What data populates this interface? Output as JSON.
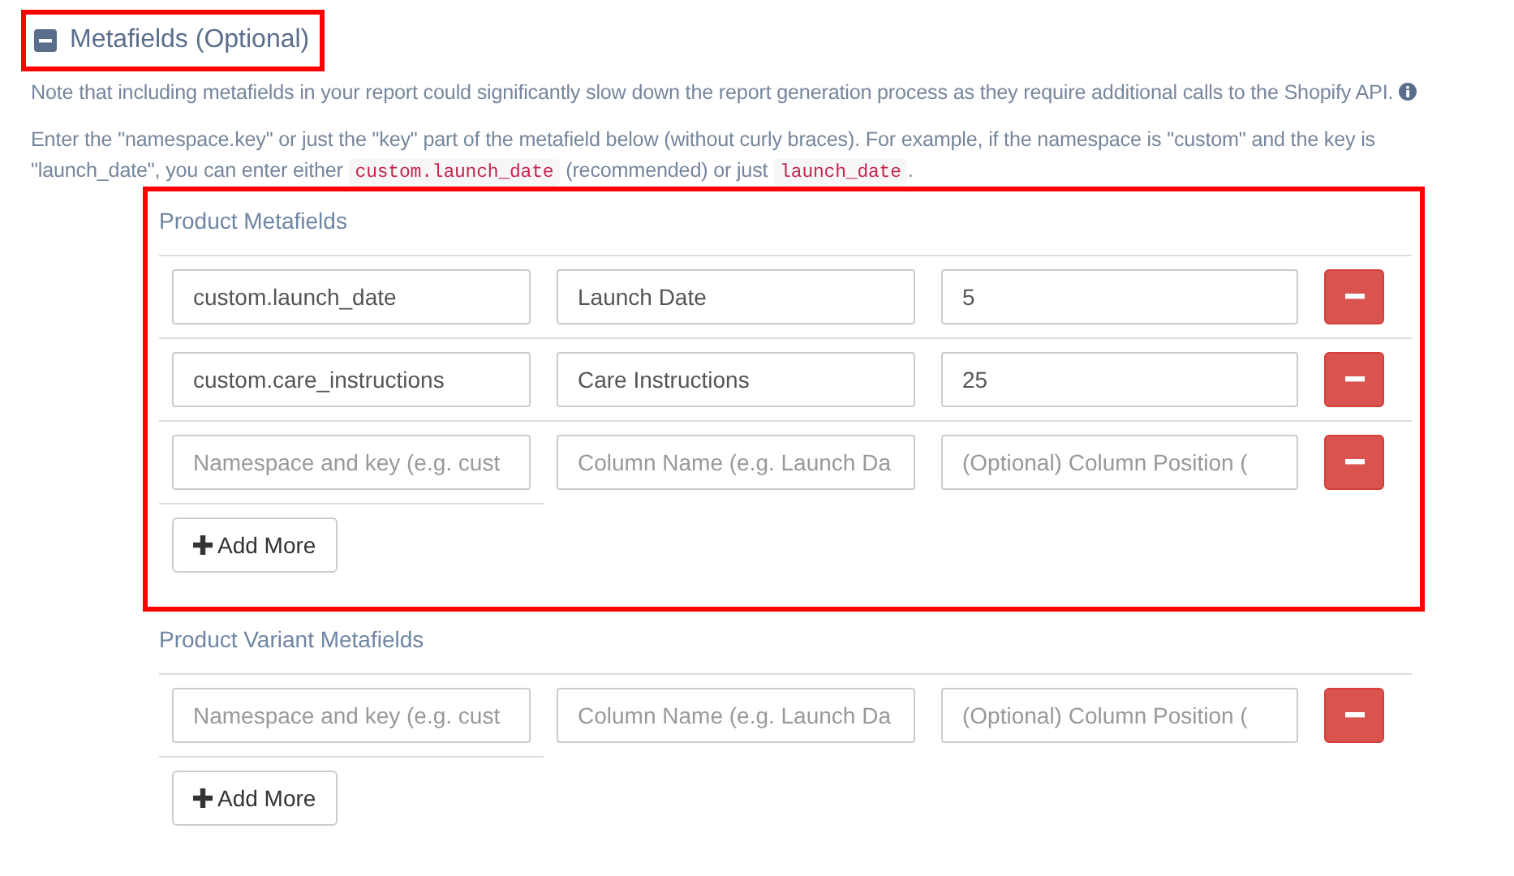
{
  "header": {
    "title": "Metafields (Optional)",
    "expanded": true,
    "highlighted": true
  },
  "note": "Note that including metafields in your report could significantly slow down the report generation process as they require additional calls to the Shopify API.",
  "instructions": [
    {
      "kind": "text",
      "text": "Enter the \"namespace.key\" or just the \"key\" part of the metafield below (without curly braces). For example, if the namespace is \"custom\" and the key is \"launch_date\", you can enter either "
    },
    {
      "kind": "code",
      "text": "custom.launch_date"
    },
    {
      "kind": "text",
      "text": " (recommended) or just "
    },
    {
      "kind": "code",
      "text": "launch_date"
    },
    {
      "kind": "text",
      "text": "."
    }
  ],
  "sections": [
    {
      "title": "Product Metafields",
      "highlighted": true,
      "rows": [
        {
          "key": {
            "value": "custom.launch_date"
          },
          "column_name": {
            "value": "Launch Date"
          },
          "position": {
            "value": "5"
          }
        },
        {
          "key": {
            "value": "custom.care_instructions"
          },
          "column_name": {
            "value": "Care Instructions"
          },
          "position": {
            "value": "25"
          }
        },
        {
          "key": {
            "placeholder": "Namespace and key (e.g. cust"
          },
          "column_name": {
            "placeholder": "Column Name (e.g. Launch Da"
          },
          "position": {
            "placeholder": "(Optional) Column Position ("
          }
        }
      ],
      "add_button": "Add More"
    },
    {
      "title": "Product Variant Metafields",
      "highlighted": false,
      "rows": [
        {
          "key": {
            "placeholder": "Namespace and key (e.g. cust"
          },
          "column_name": {
            "placeholder": "Column Name (e.g. Launch Da"
          },
          "position": {
            "placeholder": "(Optional) Column Position ("
          }
        }
      ],
      "add_button": "Add More"
    }
  ]
}
